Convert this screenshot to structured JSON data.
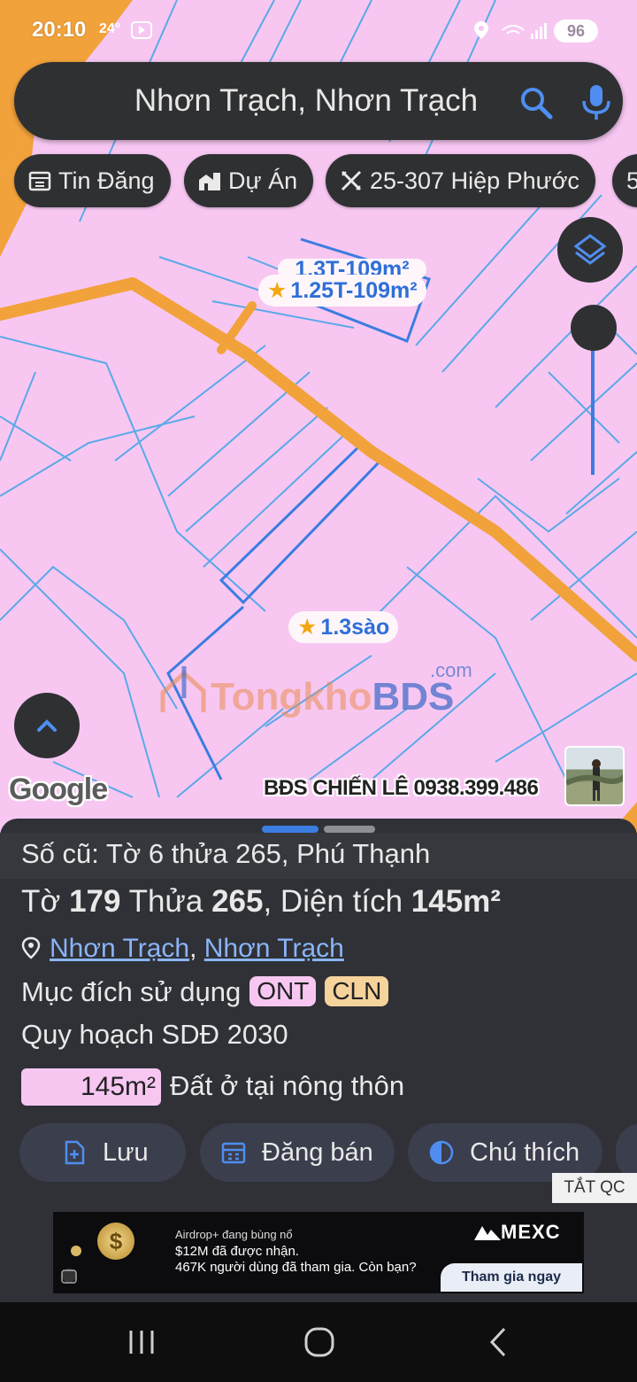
{
  "status_bar": {
    "time": "20:10",
    "temperature": "24°",
    "battery": "96",
    "icons": [
      "youtube-icon",
      "location-icon",
      "wifi-icon",
      "signal-icon",
      "battery-icon"
    ]
  },
  "search": {
    "query": "Nhơn Trạch, Nhơn Trạch",
    "icons": [
      "search-icon",
      "microphone-icon"
    ]
  },
  "chips": [
    {
      "label": "Tin Đăng",
      "icon": "calendar-icon"
    },
    {
      "label": "Dự Án",
      "icon": "building-icon"
    },
    {
      "label": "25-307 Hiệp Phước",
      "icon": "ruler-icon"
    },
    {
      "label": "5",
      "icon": ""
    }
  ],
  "map": {
    "pins": [
      {
        "label": "1.25T-109m²",
        "icon": "star-icon"
      },
      {
        "label": "1.3sào",
        "icon": "star-icon"
      }
    ],
    "ghost_pin": "1.3T-109m²",
    "watermark": {
      "prefix": "Tongkho",
      "suffix": "BDS",
      "domain": ".com"
    },
    "google_logo": "Google",
    "credit": "BĐS CHIẾN LÊ 0938.399.486",
    "colors": {
      "land": "#f7c7f2",
      "road": "#f2a23a",
      "parcel_line": "#5aa9e8",
      "highlight": "#3b7de0"
    }
  },
  "sheet": {
    "old_info": "Số cũ: Tờ 6 thửa 265, Phú Thạnh",
    "main": {
      "to_label": "Tờ",
      "to": "179",
      "thua_label": "Thửa",
      "thua": "265",
      "area_label": ", Diện tích",
      "area": "145m²"
    },
    "address": {
      "district": "Nhơn Trạch",
      "sep": ",",
      "province": "Nhơn Trạch"
    },
    "purpose_label": "Mục đích sử dụng",
    "purpose_tags": [
      "ONT",
      "CLN"
    ],
    "plan": "Quy hoạch SDĐ 2030",
    "area_box": "145m²",
    "land_use": "Đất ở tại nông thôn",
    "actions": [
      {
        "label": "Lưu",
        "icon": "add-file-icon"
      },
      {
        "label": "Đăng bán",
        "icon": "calendar-icon"
      },
      {
        "label": "Chú thích",
        "icon": "half-circle-icon"
      }
    ],
    "close_ads": "TẮT QC"
  },
  "ad": {
    "line1": "Airdrop+ đang bùng nổ",
    "line2": "$12M đã được nhận.",
    "line3": "467K người dùng đã tham gia. Còn bạn?",
    "brand": "MEXC",
    "cta": "Tham gia ngay",
    "coin": "$"
  },
  "nav": [
    "recent-apps-icon",
    "home-icon",
    "back-icon"
  ]
}
